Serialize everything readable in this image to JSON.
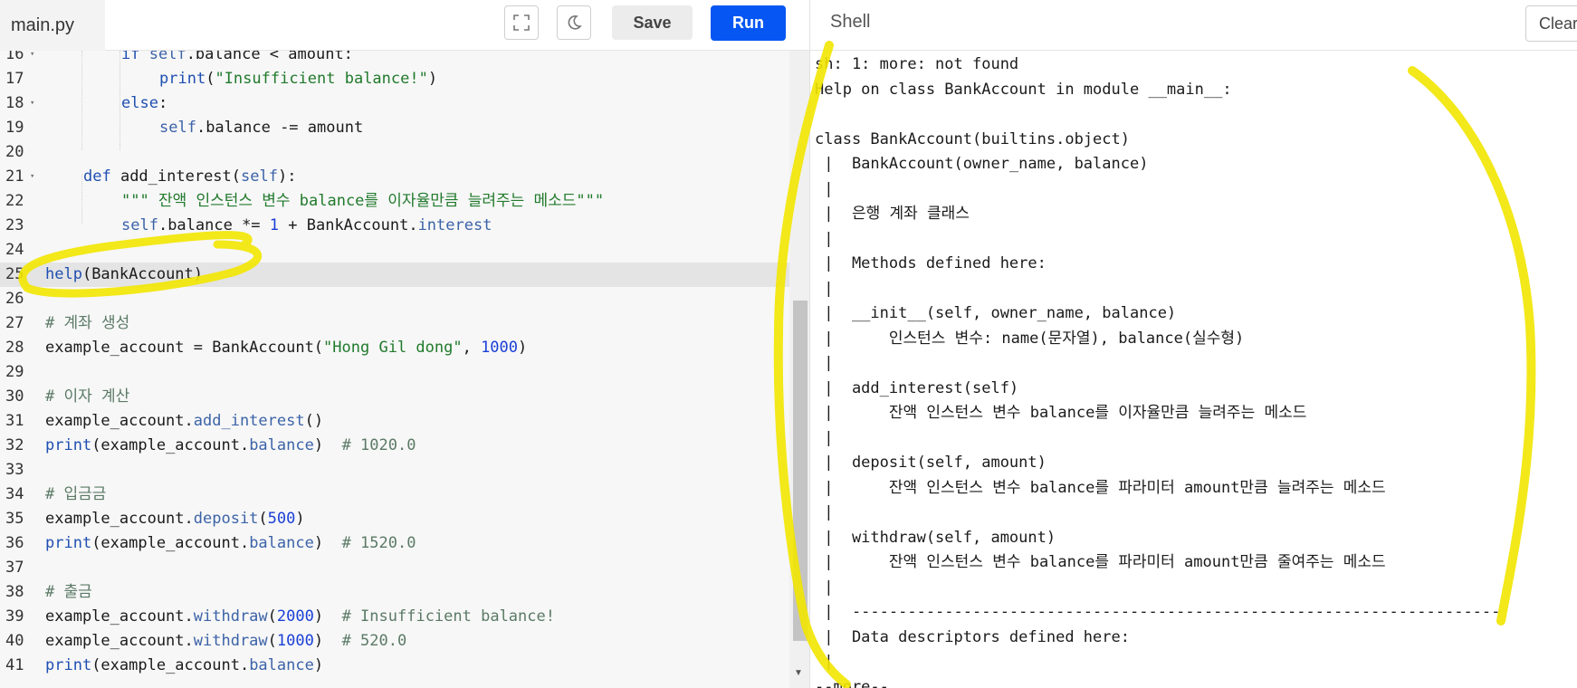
{
  "editor": {
    "file_tab": "main.py",
    "toolbar": {
      "save_label": "Save",
      "run_label": "Run"
    },
    "lines": [
      {
        "n": "16",
        "fold": true
      },
      {
        "n": "17"
      },
      {
        "n": "18",
        "fold": true
      },
      {
        "n": "19"
      },
      {
        "n": "20"
      },
      {
        "n": "21",
        "fold": true
      },
      {
        "n": "22"
      },
      {
        "n": "23"
      },
      {
        "n": "24"
      },
      {
        "n": "25",
        "active": true
      },
      {
        "n": "26"
      },
      {
        "n": "27"
      },
      {
        "n": "28"
      },
      {
        "n": "29"
      },
      {
        "n": "30"
      },
      {
        "n": "31"
      },
      {
        "n": "32"
      },
      {
        "n": "33"
      },
      {
        "n": "34"
      },
      {
        "n": "35"
      },
      {
        "n": "36"
      },
      {
        "n": "37"
      },
      {
        "n": "38"
      },
      {
        "n": "39"
      },
      {
        "n": "40"
      },
      {
        "n": "41"
      }
    ],
    "code": {
      "l16": {
        "kw": "if",
        "self": "self",
        "rest": ".balance < amount:"
      },
      "l17": {
        "fn": "print",
        "open": "(",
        "str": "\"Insufficient balance!\"",
        "close": ")"
      },
      "l18": {
        "kw": "else",
        "colon": ":"
      },
      "l19": {
        "self": "self",
        "rest": ".balance -= amount"
      },
      "l21": {
        "kw": "def",
        "name": " add_interest(",
        "self": "self",
        "close": "):"
      },
      "l22": {
        "str": "\"\"\" 잔액 인스턴스 변수 balance를 이자율만큼 늘려주는 메소드\"\"\""
      },
      "l23": {
        "self": "self",
        "mid": ".balance *= ",
        "num": "1",
        "plus": " + BankAccount.",
        "attr": "interest"
      },
      "l25": {
        "fn": "help",
        "arg": "(BankAccount)"
      },
      "l27": "# 계좌 생성",
      "l28": {
        "pre": "example_account = BankAccount(",
        "str": "\"Hong Gil dong\"",
        "sep": ", ",
        "num": "1000",
        "close": ")"
      },
      "l30": "# 이자 계산",
      "l31": {
        "pre": "example_account.",
        "attr": "add_interest",
        "close": "()"
      },
      "l32": {
        "fn": "print",
        "arg": "(example_account.",
        "attr": "balance",
        "close": ")",
        "com": "  # 1020.0"
      },
      "l34": "# 입금금",
      "l35": {
        "pre": "example_account.",
        "attr": "deposit",
        "open": "(",
        "num": "500",
        "close": ")"
      },
      "l36": {
        "fn": "print",
        "arg": "(example_account.",
        "attr": "balance",
        "close": ")",
        "com": "  # 1520.0"
      },
      "l38": "# 출금",
      "l39": {
        "pre": "example_account.",
        "attr": "withdraw",
        "open": "(",
        "num": "2000",
        "close": ")",
        "com": "  # Insufficient balance!"
      },
      "l40": {
        "pre": "example_account.",
        "attr": "withdraw",
        "open": "(",
        "num": "1000",
        "close": ")",
        "com": "  # 520.0"
      },
      "l41": {
        "fn": "print",
        "arg": "(example_account.",
        "attr": "balance",
        "close": ")"
      }
    }
  },
  "shell": {
    "title": "Shell",
    "clear_label": "Clear",
    "output_lines": [
      "sh: 1: more: not found",
      "Help on class BankAccount in module __main__:",
      "",
      "class BankAccount(builtins.object)",
      " |  BankAccount(owner_name, balance)",
      " |",
      " |  은행 계좌 클래스",
      " |",
      " |  Methods defined here:",
      " |",
      " |  __init__(self, owner_name, balance)",
      " |      인스턴스 변수: name(문자열), balance(실수형)",
      " |",
      " |  add_interest(self)",
      " |      잔액 인스턴스 변수 balance를 이자율만큼 늘려주는 메소드",
      " |",
      " |  deposit(self, amount)",
      " |      잔액 인스턴스 변수 balance를 파라미터 amount만큼 늘려주는 메소드",
      " |",
      " |  withdraw(self, amount)",
      " |      잔액 인스턴스 변수 balance를 파라미터 amount만큼 줄여주는 메소드",
      " |",
      " |  ----------------------------------------------------------------------",
      " |  Data descriptors defined here:",
      " |",
      "--more--"
    ]
  },
  "colors": {
    "run_button": "#0556f3",
    "highlighter": "#f2e600"
  }
}
